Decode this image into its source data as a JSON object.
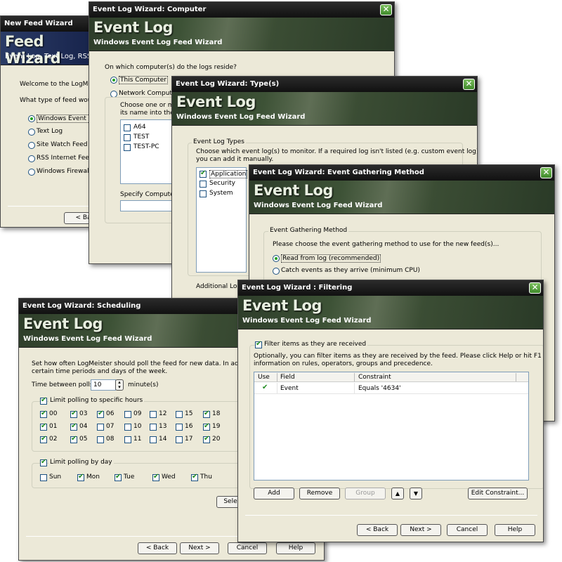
{
  "w1": {
    "title": "New Feed Wizard",
    "banner_title": "Feed Wizard",
    "banner_sub": "Event Log, Text Log, RSS",
    "welcome": "Welcome to the LogMeister",
    "question": "What type of feed would",
    "options": [
      "Windows Event Log",
      "Text Log",
      "Site Watch Feed",
      "RSS Internet Feed",
      "Windows Firewall (I"
    ],
    "back": "< Bac"
  },
  "w2": {
    "title": "Event Log Wizard: Computer",
    "banner_title": "Event Log",
    "banner_sub": "Windows Event Log Feed Wizard",
    "question": "On which computer(s) do the logs reside?",
    "this_computer": "This Computer",
    "network_computer": "Network Computer",
    "choose_line1": "Choose one or more",
    "choose_line2": "its name into the ed",
    "computers": [
      "A64",
      "TEST",
      "TEST-PC"
    ],
    "specify": "Specify Computer D"
  },
  "w3": {
    "title": "Event Log Wizard: Type(s)",
    "banner_title": "Event Log",
    "banner_sub": "Windows Event Log Feed Wizard",
    "group_label": "Event Log Types",
    "desc1": "Choose which event log(s) to monitor. If a required log isn't listed (e.g. custom event log),",
    "desc2": "you can add it manually.",
    "logs": [
      "Application",
      "Security",
      "System"
    ],
    "additional": "Additional Log:"
  },
  "w4": {
    "title": "Event Log Wizard: Event Gathering Method",
    "banner_title": "Event Log",
    "banner_sub": "Windows Event Log Feed Wizard",
    "group_label": "Event Gathering Method",
    "desc": "Please choose the event gathering method to use for the new feed(s)...",
    "opt1": "Read from log (recommended)",
    "opt2": "Catch events as they arrive (minimum CPU)"
  },
  "w5": {
    "title": "Event Log Wizard: Scheduling",
    "banner_title": "Event Log",
    "banner_sub": "Windows Event Log Feed Wizard",
    "desc1": "Set how often LogMeister should poll the feed for new data. In addition, you",
    "desc2": "certain time periods and days of the week.",
    "time_label": "Time between polls:",
    "time_value": "10",
    "time_unit": "minute(s)",
    "limit_hours": "Limit polling to specific hours",
    "hours_checked": [
      "00",
      "01",
      "02",
      "03",
      "04",
      "05",
      "06",
      "18",
      "19",
      "20"
    ],
    "hour_cols": [
      [
        "00",
        "01",
        "02"
      ],
      [
        "03",
        "04",
        "05"
      ],
      [
        "06",
        "07",
        "08"
      ],
      [
        "09",
        "10",
        "11"
      ],
      [
        "12",
        "13",
        "14"
      ],
      [
        "15",
        "16",
        "17"
      ],
      [
        "18",
        "19",
        "20"
      ]
    ],
    "limit_days": "Limit polling by day",
    "days": [
      {
        "label": "Sun",
        "checked": false
      },
      {
        "label": "Mon",
        "checked": true
      },
      {
        "label": "Tue",
        "checked": true
      },
      {
        "label": "Wed",
        "checked": true
      },
      {
        "label": "Thu",
        "checked": true
      }
    ],
    "sel_btn": "Sele",
    "back": "< Back",
    "next": "Next >",
    "cancel": "Cancel",
    "help": "Help"
  },
  "w6": {
    "title": "Event Log Wizard : Filtering",
    "banner_title": "Event Log",
    "banner_sub": "Windows Event Log Feed Wizard",
    "filter_check": "Filter items as they are received",
    "desc1": "Optionally, you can filter items as they are received by the feed. Please click Help or hit F1 for",
    "desc2": "information on rules, operators, groups and precedence.",
    "columns": [
      "Use",
      "Field",
      "Constraint"
    ],
    "rows": [
      {
        "use": true,
        "field": "Event",
        "constraint": "Equals '4634'"
      }
    ],
    "add": "Add",
    "remove": "Remove",
    "group": "Group",
    "edit": "Edit Constraint...",
    "back": "< Back",
    "next": "Next >",
    "cancel": "Cancel",
    "help": "Help"
  },
  "icons": {
    "close": "✕",
    "up": "▲",
    "down": "▼",
    "spin_up": "▴",
    "spin_down": "▾"
  }
}
